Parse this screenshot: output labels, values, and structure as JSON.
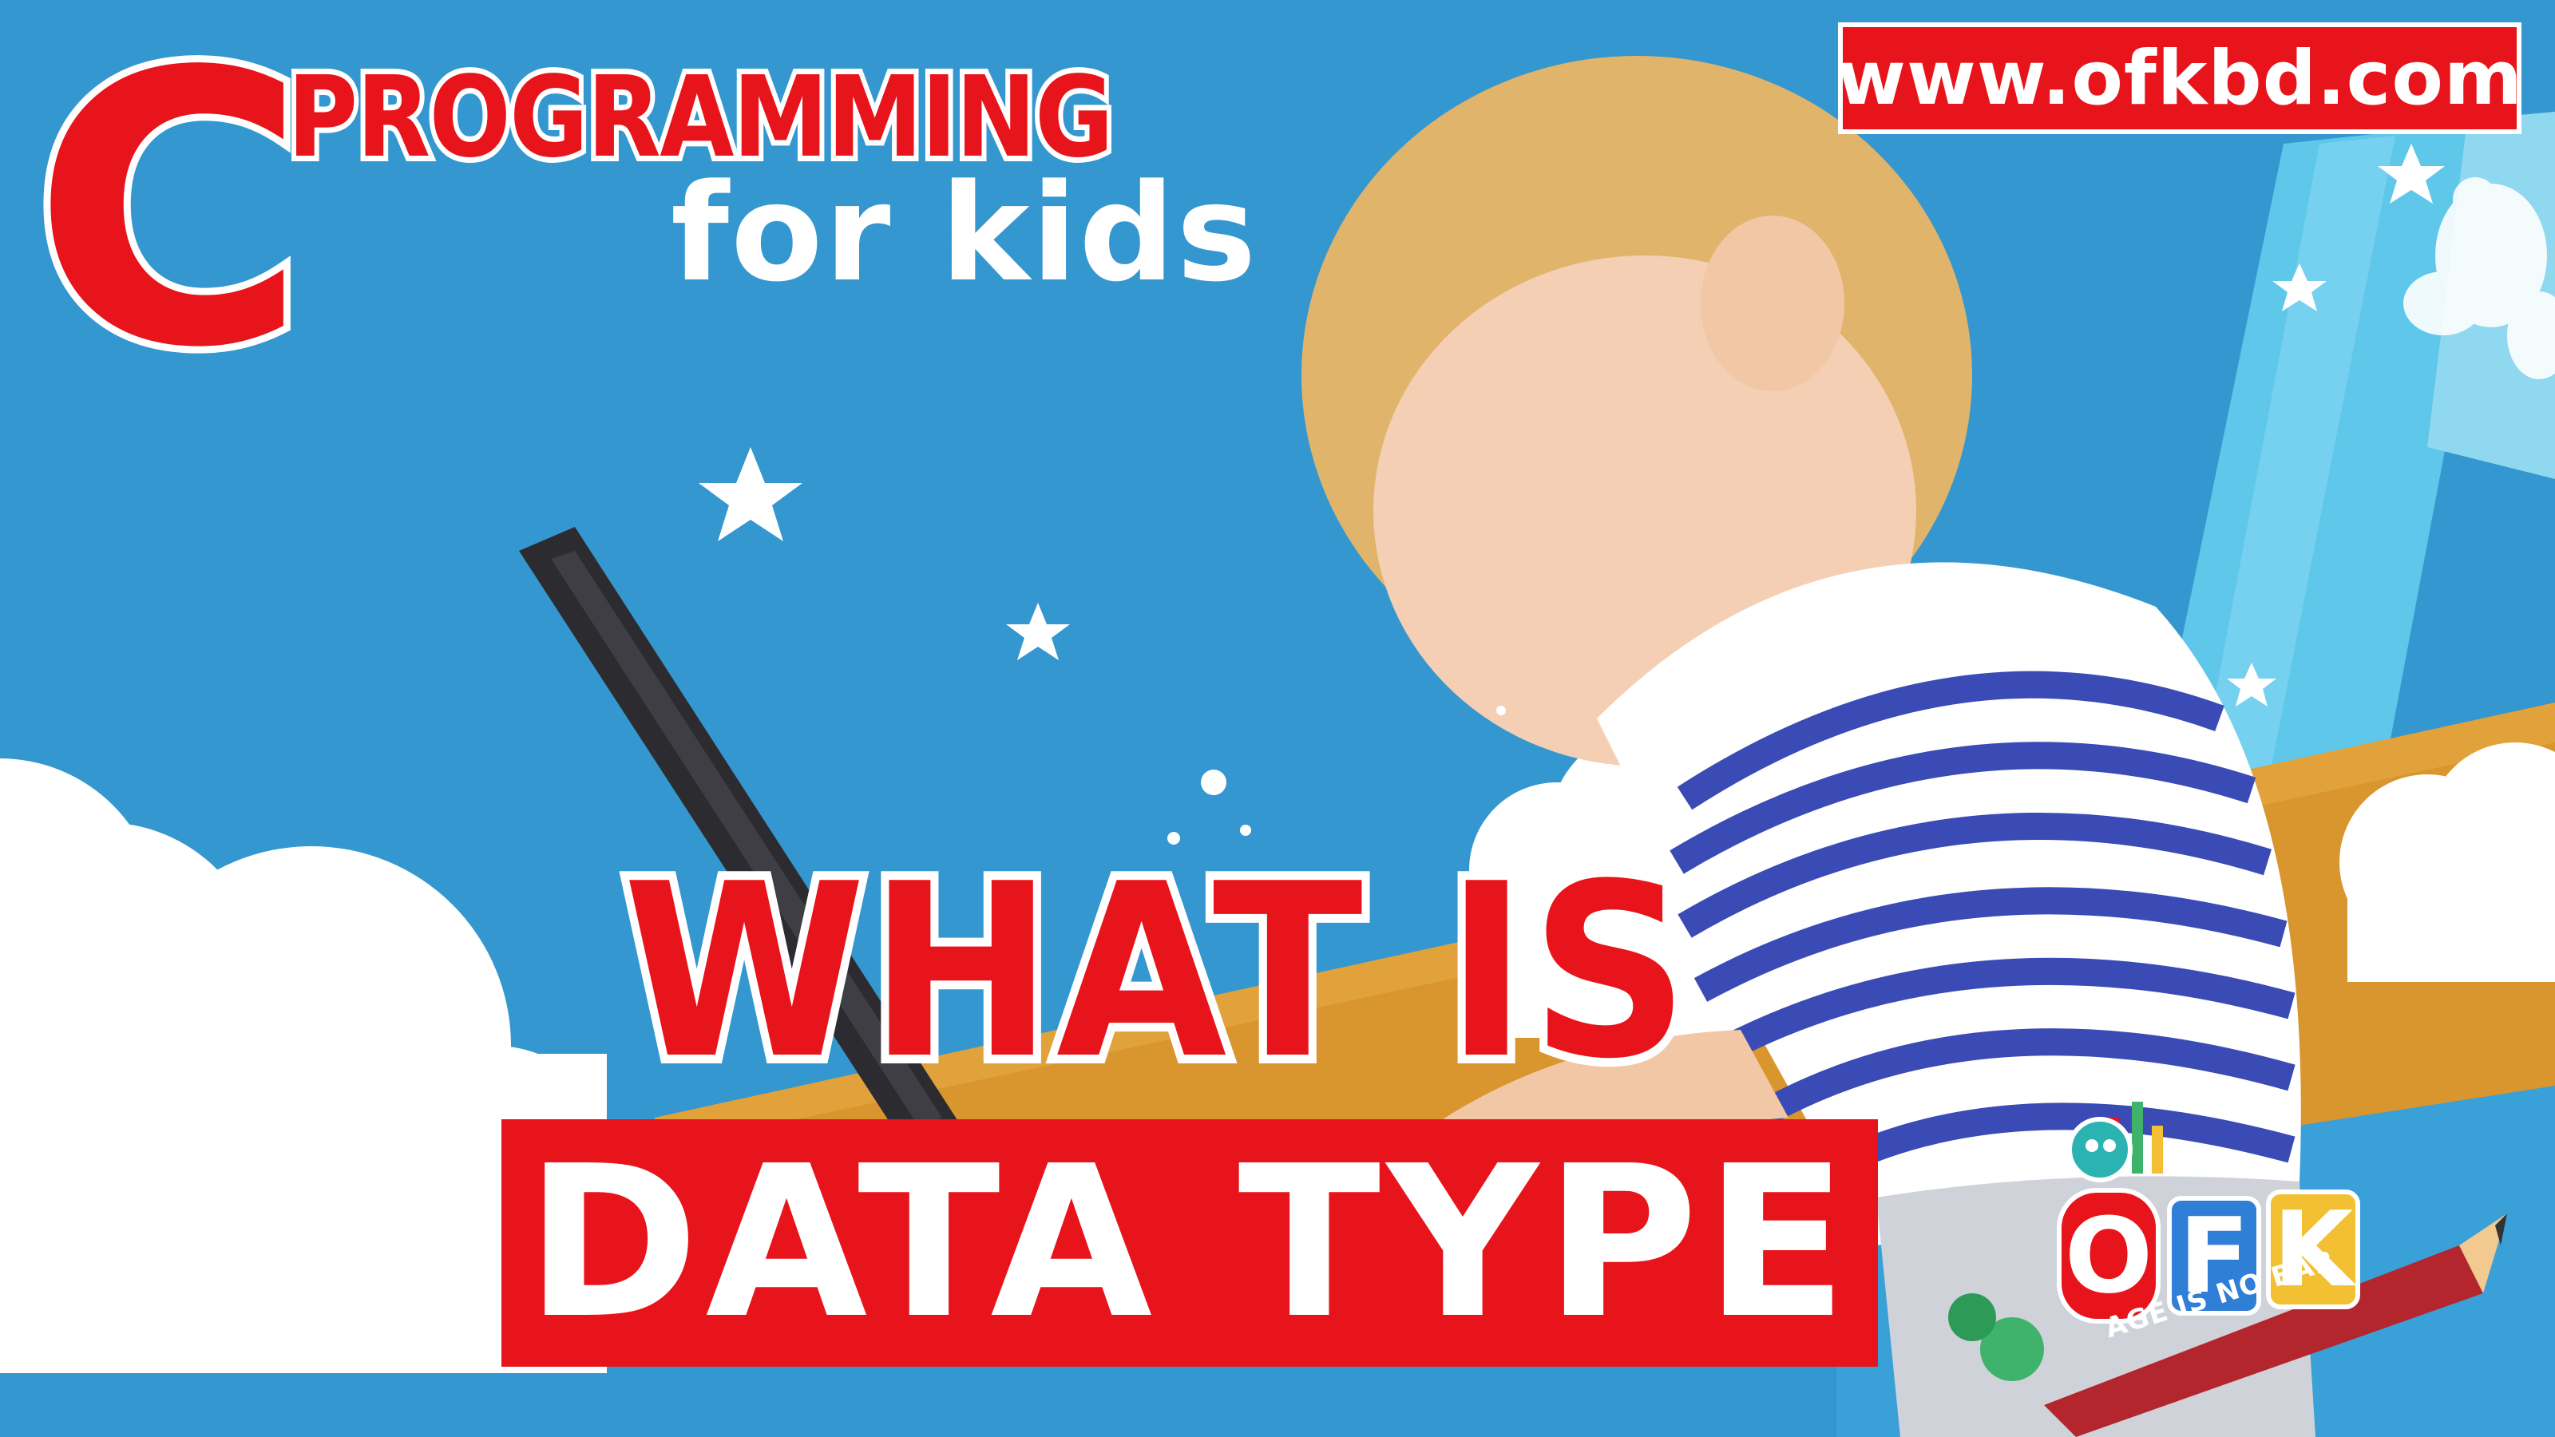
{
  "thumbnail": {
    "website": "www.ofkbd.com",
    "title": {
      "letter": "C",
      "line1": "PROGRAMMING",
      "line2": "for kids"
    },
    "headline": {
      "line1": "WHAT IS",
      "line2": "DATA TYPE"
    },
    "logo": {
      "letters": [
        "O",
        "F",
        "K"
      ],
      "tagline": "AGE IS NO BAR"
    }
  },
  "colors": {
    "sky": "#3597cf",
    "brand_red": "#e8141b",
    "white": "#ffffff",
    "orange_band": "#d9952e",
    "stripe_blue": "#3a4bb5"
  },
  "icons": [
    "star-icon",
    "cloud-shape",
    "laptop-shape",
    "pencil-shape",
    "logo-mascot"
  ]
}
